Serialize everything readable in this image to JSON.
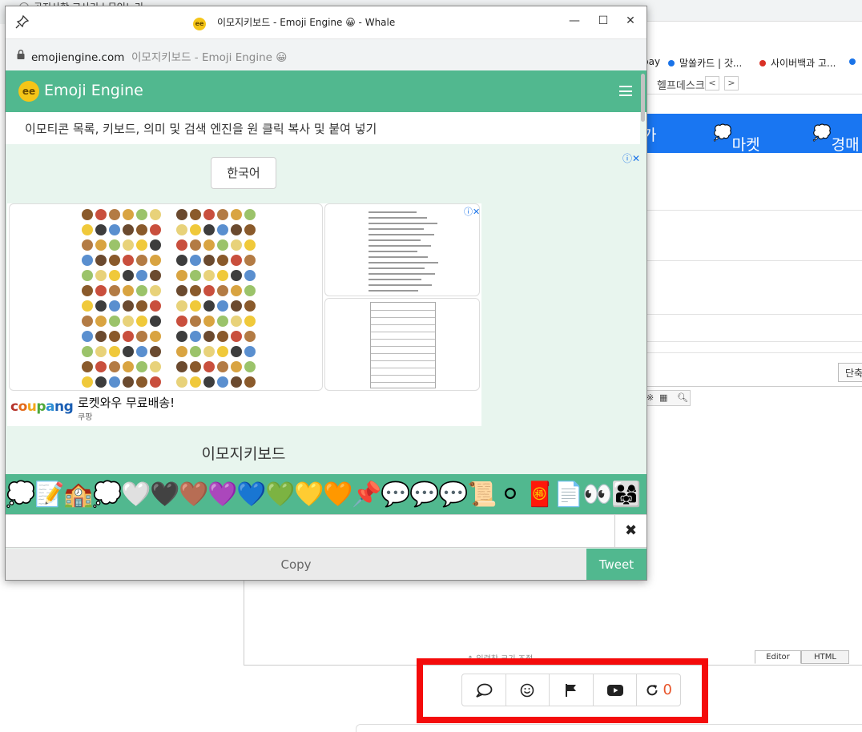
{
  "background_page": {
    "tab_label": "공지사항 고사기 | 무인노리",
    "bookmarks": [
      {
        "label": "pay",
        "color": ""
      },
      {
        "label": "말쏠카드 | 갓...",
        "color": "#1a73e8"
      },
      {
        "label": "사이버백과 고...",
        "color": "#d93025"
      },
      {
        "label": "",
        "color": "#1a73e8"
      }
    ],
    "helpdesk_label": "헬프데스크",
    "nav_prev": "<",
    "nav_next": ">",
    "menu_items": [
      "가",
      "마켓",
      "경매"
    ],
    "shrink_button": "단축",
    "resize_hint": "입력창 크기 조절",
    "mode_tabs": [
      "Editor",
      "HTML"
    ],
    "reaction_count": "0",
    "accent_blue": "#1976f2",
    "highlight_color": "#f40b0b"
  },
  "popup": {
    "window_title": "이모지키보드 - Emoji Engine 😀 - Whale",
    "window_badge": "ee",
    "controls": {
      "minimize": "—",
      "maximize": "☐",
      "close": "✕"
    },
    "address_domain": "emojiengine.com",
    "address_title": "이모지키보드 - Emoji Engine 😀",
    "site": {
      "logo_badge": "ee",
      "logo_text": "Emoji Engine",
      "tagline": "이모티콘 목록, 키보드, 의미 및 검색 엔진을 원 클릭 복사 및 붙여 넣기",
      "language_button": "한국어",
      "ad_choices": "ⓘ✕",
      "ad": {
        "brand": [
          "c",
          "o",
          "u",
          "p",
          "a",
          "n",
          "g"
        ],
        "headline": "로켓와우 무료배송!",
        "advertiser": "쿠팡"
      },
      "section_title": "이모지키보드",
      "emoji_strip": [
        "💭",
        "📝",
        "🏫",
        "💭",
        "🤍",
        "🖤",
        "🤎",
        "💜",
        "💙",
        "💚",
        "💛",
        "🧡",
        "📌",
        "💬",
        "💬",
        "💬",
        "📜",
        "⚪",
        "🧧",
        "📄",
        "👀",
        "👨‍👩‍👧"
      ],
      "emoji_input_value": "",
      "clear_label": "✖",
      "copy_label": "Copy",
      "tweet_label": "Tweet",
      "brand_color": "#51b88f"
    }
  }
}
